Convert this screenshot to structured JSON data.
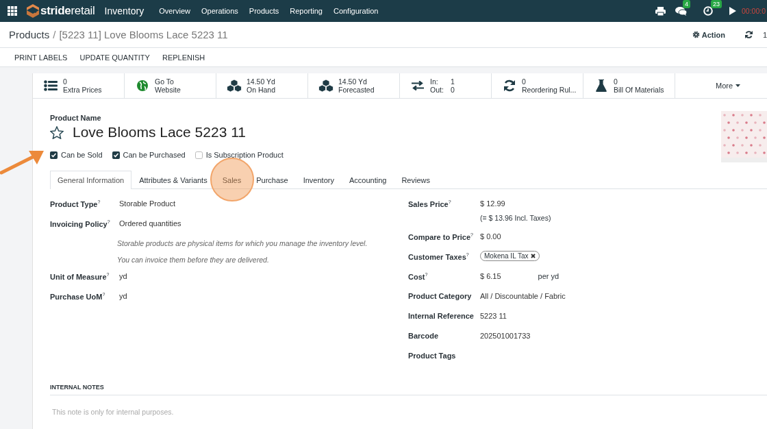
{
  "navbar": {
    "brand": "**stride**retail",
    "app": "Inventory",
    "menus": [
      "Overview",
      "Operations",
      "Products",
      "Reporting",
      "Configuration"
    ],
    "messages_badge": "4",
    "activities_badge": "23",
    "timer": "00:00:0"
  },
  "control_panel": {
    "breadcrumb": "Products",
    "separator": "/",
    "record": "[5223 11] Love Blooms Lace 5223 11",
    "action": "Action",
    "pager": "1"
  },
  "action_buttons": [
    "PRINT LABELS",
    "UPDATE QUANTITY",
    "REPLENISH"
  ],
  "smart_buttons": [
    {
      "kind": "list",
      "value": "0",
      "label": "Extra Prices"
    },
    {
      "kind": "globe",
      "value": "Go To",
      "label": "Website"
    },
    {
      "kind": "cubes",
      "value": "14.50 Yd",
      "label": "On Hand"
    },
    {
      "kind": "cubes",
      "value": "14.50 Yd",
      "label": "Forecasted"
    },
    {
      "kind": "arrows",
      "rows": [
        {
          "label": "In:",
          "value": "1"
        },
        {
          "label": "Out:",
          "value": "0"
        }
      ]
    },
    {
      "kind": "refresh",
      "value": "0",
      "label": "Reordering Rul..."
    },
    {
      "kind": "flask",
      "value": "0",
      "label": "Bill Of Materials"
    },
    {
      "kind": "more",
      "label": "More"
    }
  ],
  "product": {
    "name_label": "Product Name",
    "name": "Love Blooms Lace 5223 11",
    "favorite": false
  },
  "options": [
    {
      "label": "Can be Sold",
      "checked": true,
      "pointed": true
    },
    {
      "label": "Can be Purchased",
      "checked": true,
      "pointed": false
    },
    {
      "label": "Is Subscription Product",
      "checked": false,
      "pointed": false
    }
  ],
  "tabs": [
    {
      "label": "General Information",
      "selected": true,
      "highlighted": false
    },
    {
      "label": "Attributes & Variants",
      "selected": false,
      "highlighted": false
    },
    {
      "label": "Sales",
      "selected": false,
      "highlighted": true
    },
    {
      "label": "Purchase",
      "selected": false,
      "highlighted": false
    },
    {
      "label": "Inventory",
      "selected": false,
      "highlighted": false
    },
    {
      "label": "Accounting",
      "selected": false,
      "highlighted": false
    },
    {
      "label": "Reviews",
      "selected": false,
      "highlighted": false
    }
  ],
  "left_fields": [
    {
      "kind": "text",
      "label": "Product Type$^{?}$",
      "value": "Storable Product"
    },
    {
      "kind": "text",
      "label": "Invoicing Policy$^{?}$",
      "value": "Ordered quantities"
    },
    {
      "kind": "note",
      "value": "Storable products are physical items for which you manage the inventory level."
    },
    {
      "kind": "note",
      "value": "You can invoice them before they are delivered."
    },
    {
      "kind": "text",
      "label": "Unit of Measure$^{?}$",
      "value": "yd"
    },
    {
      "kind": "text",
      "label": "Purchase UoM$^{?}$",
      "value": "yd"
    }
  ],
  "right_fields": [
    {
      "kind": "text",
      "label": "Sales Price$^{?}$",
      "value": "$ 12.99"
    },
    {
      "kind": "sub",
      "value": "(= $ 13.96 Incl. Taxes)"
    },
    {
      "kind": "text",
      "label": "Compare to Price$^{?}$",
      "value": "$ 0.00"
    },
    {
      "kind": "tag",
      "label": "Customer Taxes$^{?}$",
      "value": "Mokena IL Tax"
    },
    {
      "kind": "unit",
      "label": "Cost$^{?}$",
      "value": "$ 6.15",
      "unit": "per yd"
    },
    {
      "kind": "text",
      "label": "Product Category",
      "value": "All / Discountable / Fabric"
    },
    {
      "kind": "text",
      "label": "Internal Reference",
      "value": "5223 11"
    },
    {
      "kind": "text",
      "label": "Barcode",
      "value": "202501001733"
    },
    {
      "kind": "empty",
      "label": "Product Tags"
    }
  ],
  "internal_notes": {
    "title": "INTERNAL NOTES",
    "placeholder": "This note is only for internal purposes."
  }
}
